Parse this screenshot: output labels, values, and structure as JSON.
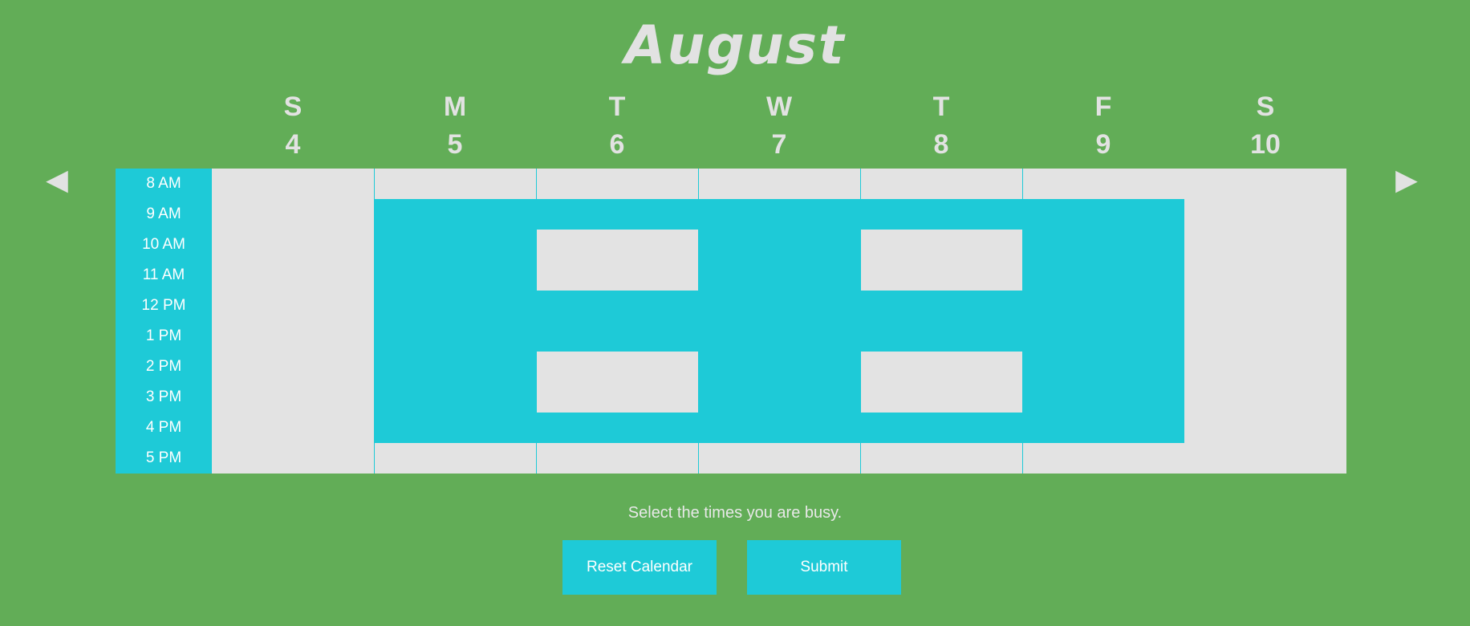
{
  "month": "August",
  "nav": {
    "prev": "◀",
    "next": "▶"
  },
  "days": [
    {
      "dow": "S",
      "date": "4"
    },
    {
      "dow": "M",
      "date": "5"
    },
    {
      "dow": "T",
      "date": "6"
    },
    {
      "dow": "W",
      "date": "7"
    },
    {
      "dow": "T",
      "date": "8"
    },
    {
      "dow": "F",
      "date": "9"
    },
    {
      "dow": "S",
      "date": "10"
    }
  ],
  "times": [
    "8 AM",
    "9 AM",
    "10 AM",
    "11 AM",
    "12 PM",
    "1 PM",
    "2 PM",
    "3 PM",
    "4 PM",
    "5 PM"
  ],
  "busy": [
    [
      false,
      false,
      false,
      false,
      false,
      false,
      false,
      false,
      false,
      false
    ],
    [
      false,
      true,
      true,
      true,
      true,
      true,
      true,
      true,
      true,
      false
    ],
    [
      false,
      true,
      false,
      false,
      true,
      true,
      false,
      false,
      true,
      false
    ],
    [
      false,
      true,
      true,
      true,
      true,
      true,
      true,
      true,
      true,
      false
    ],
    [
      false,
      true,
      false,
      false,
      true,
      true,
      false,
      false,
      true,
      false
    ],
    [
      false,
      true,
      true,
      true,
      true,
      true,
      true,
      true,
      true,
      false
    ],
    [
      false,
      false,
      false,
      false,
      false,
      false,
      false,
      false,
      false,
      false
    ]
  ],
  "instructions": "Select the times you are busy.",
  "buttons": {
    "reset": "Reset Calendar",
    "submit": "Submit"
  },
  "colors": {
    "background": "#62ad57",
    "busy": "#1ecad7",
    "free": "#e3e3e3"
  }
}
